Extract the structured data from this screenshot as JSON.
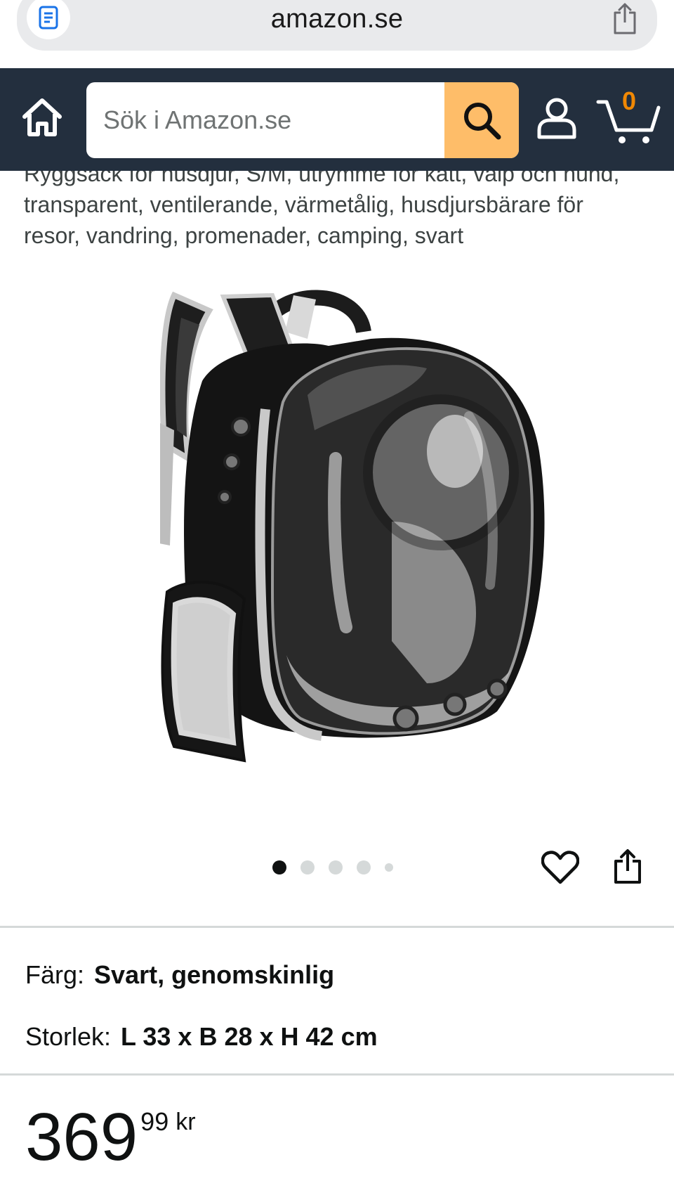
{
  "browser": {
    "url": "amazon.se",
    "icons": {
      "reader": "reader-icon",
      "share": "share-icon"
    }
  },
  "header": {
    "search_placeholder": "Sök i Amazon.se",
    "cart_count": "0",
    "icons": {
      "home": "home-icon",
      "search": "search-icon",
      "account": "account-icon",
      "cart": "cart-icon"
    },
    "colors": {
      "background": "#232f3e",
      "search_button": "#febd69",
      "cart_count": "#f08804"
    }
  },
  "product": {
    "title": "Ryggsäck för husdjur, S/M, utrymme för katt, valp och hund, transparent, ventilerande, värmetålig, husdjursbärare för resor, vandring, promenader, camping, svart",
    "image_alt": "Ryggsäck för husdjur",
    "carousel": {
      "total_dots": 5,
      "active_index": 0
    },
    "actions": {
      "wishlist_icon": "heart-icon",
      "share_icon": "share-icon"
    }
  },
  "variations": {
    "color_label": "Färg:",
    "color_value": "Svart, genomskinlig",
    "size_label": "Storlek:",
    "size_value": "L 33 x B 28 x H 42 cm"
  },
  "price": {
    "whole": "369",
    "fraction": "99",
    "currency": "kr"
  }
}
